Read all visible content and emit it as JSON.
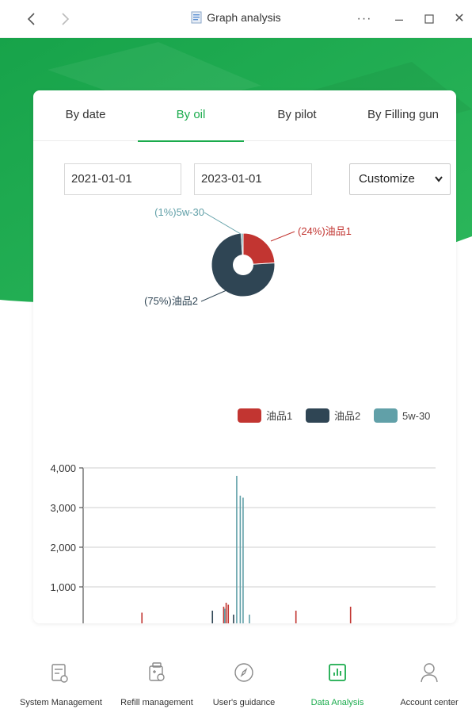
{
  "window": {
    "title": "Graph analysis",
    "back_icon": "chevron-left-icon",
    "forward_icon": "chevron-right-icon",
    "more_label": "···",
    "minimize_label": "–",
    "maximize_label": "☐",
    "close_label": "✕"
  },
  "tabs": [
    {
      "label": "By date",
      "active": false
    },
    {
      "label": "By oil",
      "active": true
    },
    {
      "label": "By pilot",
      "active": false
    },
    {
      "label": "By Filling gun",
      "active": false
    }
  ],
  "filters": {
    "start_date": "2021-01-01",
    "end_date": "2023-01-01",
    "range_select": "Customize"
  },
  "colors": {
    "accent": "#1aab4c",
    "oil1": "#c23531",
    "oil2": "#2f4554",
    "oil3": "#61a0a8"
  },
  "chart_data": [
    {
      "type": "pie",
      "donut": true,
      "slices": [
        {
          "name": "油品1",
          "percent": 24,
          "label": "(24%)油品1",
          "color": "#c23531"
        },
        {
          "name": "油品2",
          "percent": 75,
          "label": "(75%)油品2",
          "color": "#2f4554"
        },
        {
          "name": "5w-30",
          "percent": 1,
          "label": "(1%)5w-30",
          "color": "#61a0a8"
        }
      ],
      "legend": {
        "placement": "right",
        "entries": [
          "油品1",
          "油品2",
          "5w-30"
        ]
      }
    },
    {
      "type": "bar",
      "yticks": [
        "4,000",
        "3,000",
        "2,000",
        "1,000"
      ],
      "ylim": [
        0,
        4000
      ],
      "grid": true,
      "series": [
        {
          "name": "油品1",
          "color": "#c23531",
          "points": [
            [
              0.165,
              350
            ],
            [
              0.397,
              500
            ],
            [
              0.404,
              600
            ],
            [
              0.41,
              550
            ],
            [
              0.602,
              400
            ],
            [
              0.757,
              500
            ]
          ]
        },
        {
          "name": "油品2",
          "color": "#2f4554",
          "points": [
            [
              0.365,
              400
            ],
            [
              0.425,
              300
            ]
          ]
        },
        {
          "name": "5w-30",
          "color": "#61a0a8",
          "points": [
            [
              0.4,
              450
            ],
            [
              0.434,
              3800
            ],
            [
              0.444,
              3300
            ],
            [
              0.452,
              3250
            ],
            [
              0.47,
              300
            ]
          ]
        }
      ]
    }
  ],
  "bottom_nav": [
    {
      "label": "System Management",
      "icon": "system-management-icon",
      "active": false
    },
    {
      "label": "Refill management",
      "icon": "refill-management-icon",
      "active": false
    },
    {
      "label": "User's guidance",
      "icon": "compass-icon",
      "active": false
    },
    {
      "label": "Data Analysis",
      "icon": "bar-chart-icon",
      "active": true
    },
    {
      "label": "Account center",
      "icon": "user-icon",
      "active": false
    }
  ]
}
